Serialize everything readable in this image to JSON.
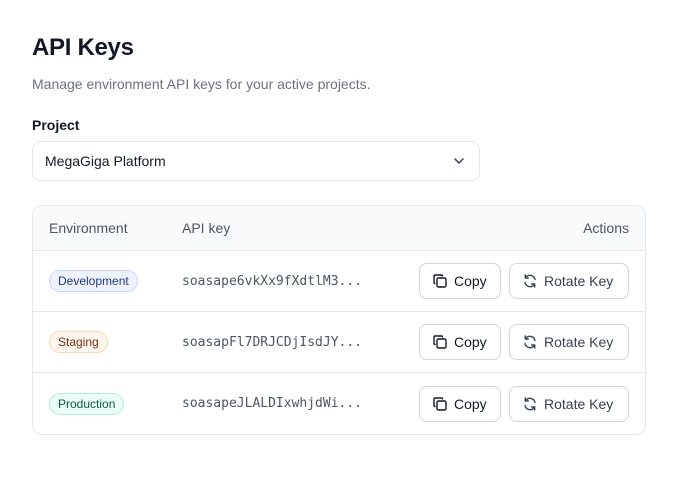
{
  "header": {
    "title": "API Keys",
    "subtitle": "Manage environment API keys for your active projects."
  },
  "project": {
    "label": "Project",
    "selected": "MegaGiga Platform"
  },
  "table": {
    "columns": {
      "environment": "Environment",
      "api_key": "API key",
      "actions": "Actions"
    },
    "rows": [
      {
        "environment": "Development",
        "api_key": "soasape6vkXx9fXdtlM3...",
        "copy_label": "Copy",
        "rotate_label": "Rotate Key"
      },
      {
        "environment": "Staging",
        "api_key": "soasapFl7DRJCDjIsdJY...",
        "copy_label": "Copy",
        "rotate_label": "Rotate Key"
      },
      {
        "environment": "Production",
        "api_key": "soasapeJLALDIxwhjdWi...",
        "copy_label": "Copy",
        "rotate_label": "Rotate Key"
      }
    ]
  },
  "icons": {
    "select": "chevron-down-icon",
    "copy": "copy-icon",
    "rotate": "refresh-icon"
  },
  "colors": {
    "development": "#1e3a8a",
    "staging": "#7c2d12",
    "production": "#065f46"
  }
}
